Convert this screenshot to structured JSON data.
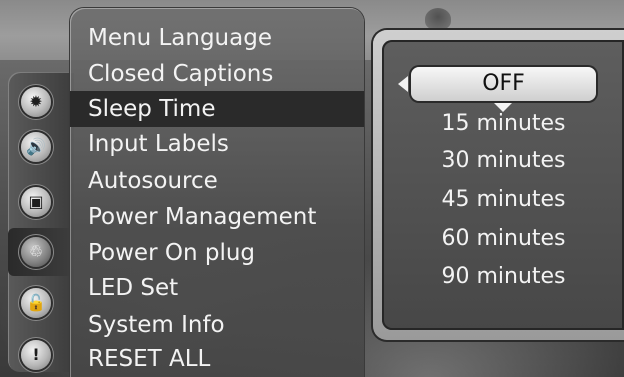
{
  "menu": {
    "items": [
      {
        "label": "Menu Language"
      },
      {
        "label": "Closed Captions"
      },
      {
        "label": "Sleep Time",
        "selected": true
      },
      {
        "label": "Input Labels"
      },
      {
        "label": "Autosource"
      },
      {
        "label": "Power Management"
      },
      {
        "label": "Power On plug"
      },
      {
        "label": "LED Set"
      },
      {
        "label": "System Info"
      },
      {
        "label": "RESET ALL"
      }
    ]
  },
  "rail": {
    "icons": [
      {
        "name": "picture-settings-icon",
        "glyph": "✹"
      },
      {
        "name": "audio-icon",
        "glyph": "🔊"
      },
      {
        "name": "tv-icon",
        "glyph": "▣"
      },
      {
        "name": "setup-icon",
        "glyph": "♲",
        "active": true
      },
      {
        "name": "lock-icon",
        "glyph": "🔓"
      },
      {
        "name": "help-icon",
        "glyph": "!"
      }
    ]
  },
  "sleep_time": {
    "current_value": "OFF",
    "options": [
      "15 minutes",
      "30 minutes",
      "45 minutes",
      "60 minutes",
      "90 minutes"
    ]
  },
  "colors": {
    "selection_bg": "#2a2a2a",
    "menu_text": "#f3f3f3",
    "current_value_bg": "#e6e6e6"
  }
}
